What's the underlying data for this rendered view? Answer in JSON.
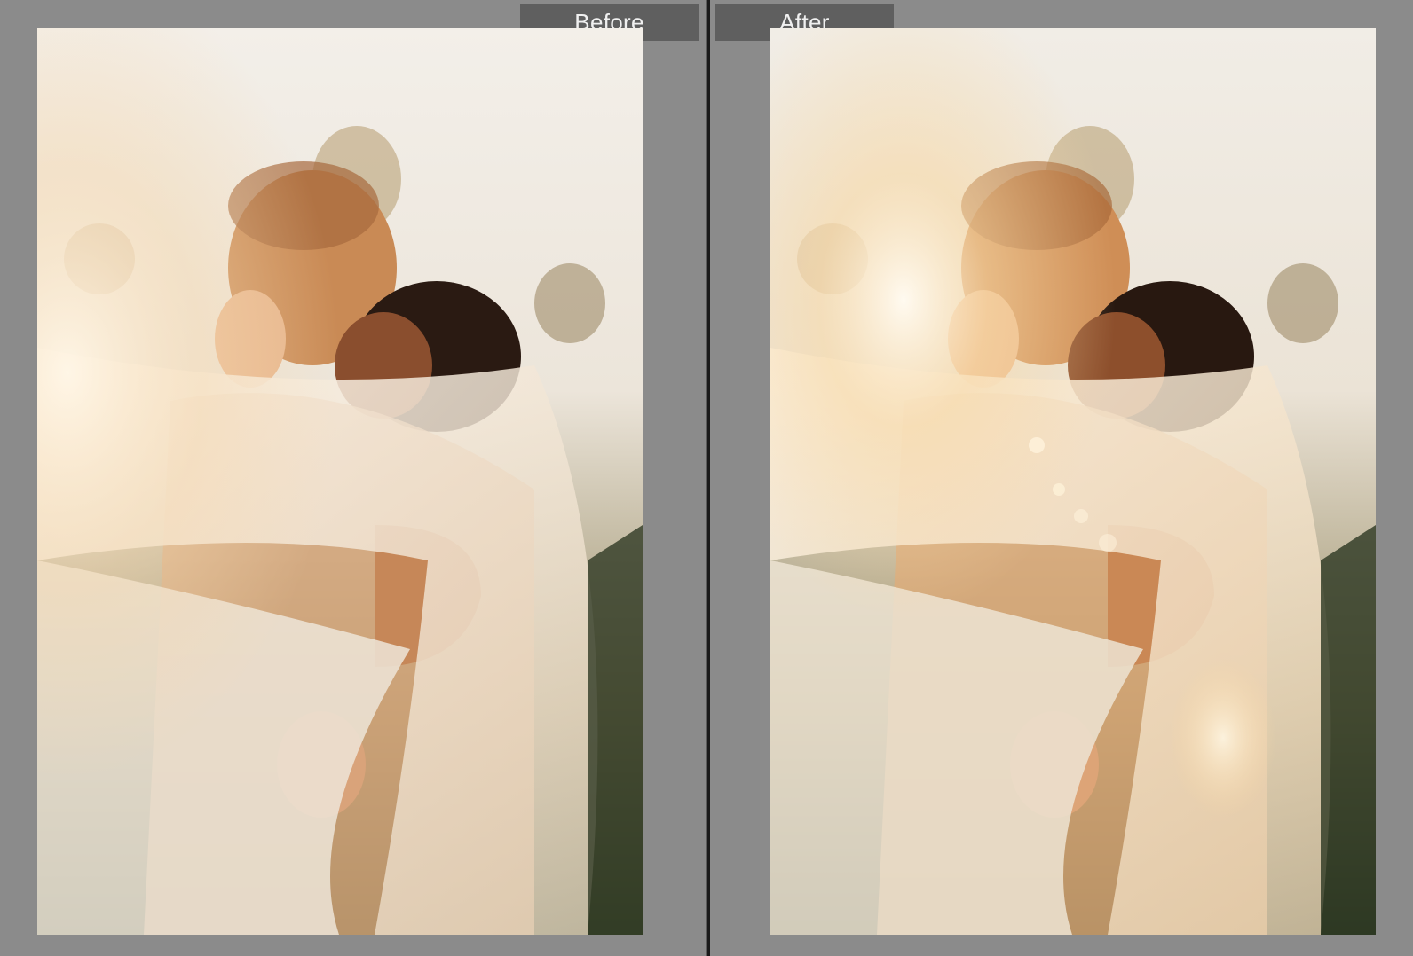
{
  "comparison": {
    "before_label": "Before",
    "after_label": "After"
  },
  "colors": {
    "background": "#8b8b8b",
    "label_tab": "#5f5f5f",
    "divider": "#1a1a1a",
    "label_text": "#f0f0f0"
  },
  "photo": {
    "subject": "wedding-couple-veil-sunset"
  }
}
